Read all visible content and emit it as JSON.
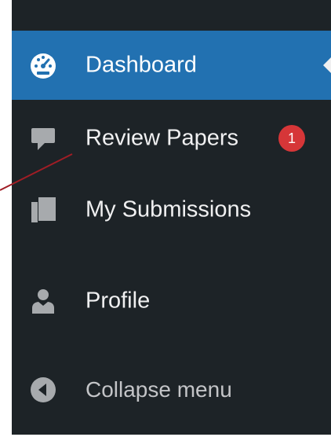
{
  "sidebar": {
    "items": [
      {
        "label": "Dashboard",
        "icon": "dashboard-icon",
        "active": true
      },
      {
        "label": "Review Papers",
        "icon": "comment-icon",
        "badge": "1"
      },
      {
        "label": "My Submissions",
        "icon": "submissions-icon"
      },
      {
        "label": "Profile",
        "icon": "user-icon"
      },
      {
        "label": "Collapse menu",
        "icon": "collapse-icon"
      }
    ]
  },
  "colors": {
    "sidebar_bg": "#1d2327",
    "active_bg": "#2271b1",
    "badge_bg": "#d63638",
    "annotation_line": "#a01d25"
  }
}
